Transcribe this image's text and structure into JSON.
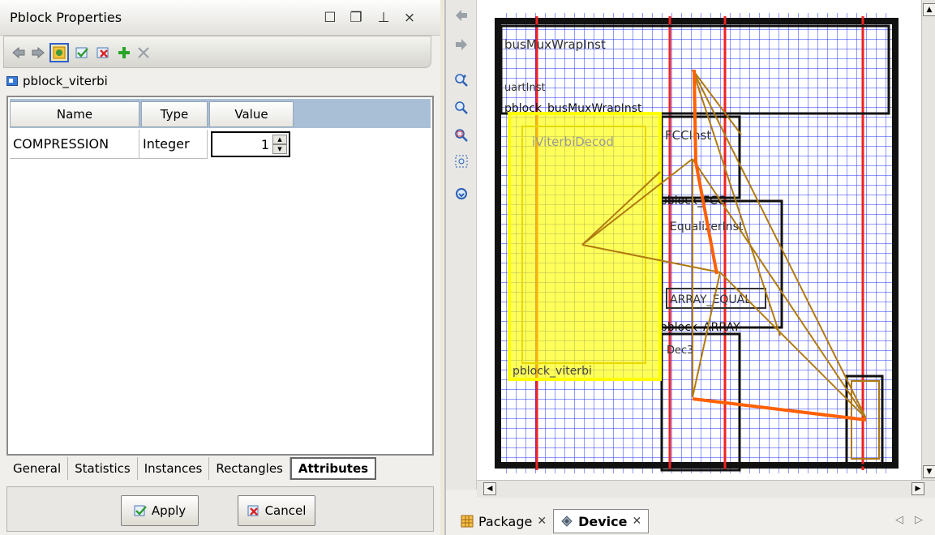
{
  "left_panel": {
    "title": "Pblock Properties",
    "controls": {
      "maximize": "☐",
      "restore": "❐",
      "pin": "⊥",
      "close": "×"
    },
    "pblock_name": "pblock_viterbi",
    "table": {
      "headers": [
        "Name",
        "Type",
        "Value"
      ],
      "rows": [
        {
          "name": "COMPRESSION",
          "type": "Integer",
          "value": "1"
        }
      ]
    },
    "tabs": [
      "General",
      "Statistics",
      "Instances",
      "Rectangles",
      "Attributes"
    ],
    "active_tab": "Attributes",
    "buttons": {
      "apply": "Apply",
      "cancel": "Cancel"
    }
  },
  "right_panel": {
    "labels": {
      "bus": "busMuxWrapInst",
      "uart": "uartInst",
      "pblock_bus": "pblock_busMuxWrapInst",
      "viterbi_inst": "iViterbiDecod",
      "fcc": "FCCInst",
      "pblock_fcc": "pblock_FCC",
      "equalizer": "EqualizerInst",
      "array_equal": "ARRAY_EQUAL",
      "pblock_array": "pblock_ARRAY",
      "pblock_viterbi": "pblock_viterbi",
      "dec": "Dec3"
    },
    "bottom_tabs": [
      {
        "label": "Package",
        "active": false
      },
      {
        "label": "Device",
        "active": true
      }
    ],
    "colors": {
      "highlight": "#ffff00",
      "grid": "#0000ff",
      "net": "#b07a10",
      "critical": "#ff6000"
    }
  }
}
